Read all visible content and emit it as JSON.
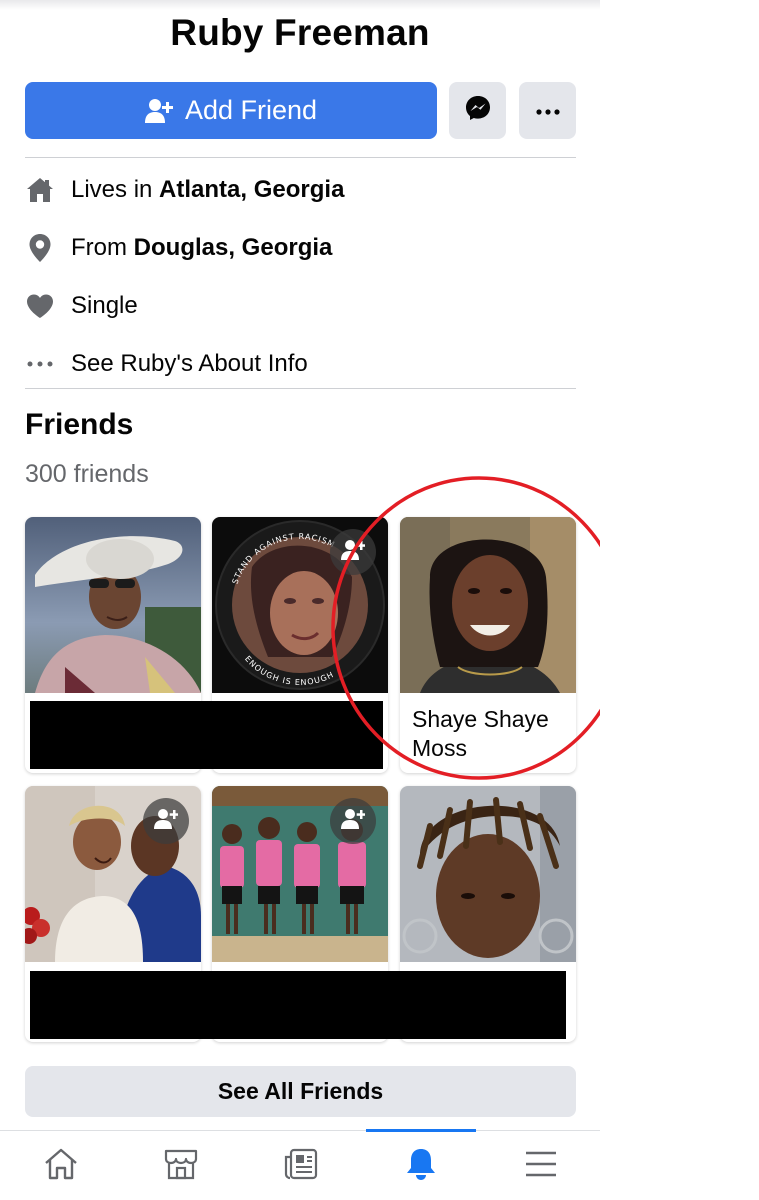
{
  "profile": {
    "name": "Ruby Freeman"
  },
  "actions": {
    "add_friend_label": "Add Friend"
  },
  "intro": {
    "lives_prefix": "Lives in ",
    "lives_value": "Atlanta, Georgia",
    "from_prefix": "From ",
    "from_value": "Douglas, Georgia",
    "relationship": "Single",
    "about_link": "See Ruby's About Info"
  },
  "friends": {
    "title": "Friends",
    "count": "300 friends",
    "highlighted_name": "Shaye Shaye Moss",
    "see_all_label": "See All Friends",
    "photo_texts": {
      "badge_top": "STAND AGAINST RACISM",
      "badge_side": "ENOUGH IS ENOUGH"
    }
  },
  "colors": {
    "primary": "#3a78e8",
    "secondary_button": "#e4e6eb",
    "muted_text": "#65676b",
    "icon_gray": "#65676b",
    "active_tab": "#1877f2",
    "annotation_red": "#e31e25"
  },
  "tabs": [
    "home-icon",
    "marketplace-icon",
    "news-icon",
    "notifications-icon",
    "menu-icon"
  ]
}
